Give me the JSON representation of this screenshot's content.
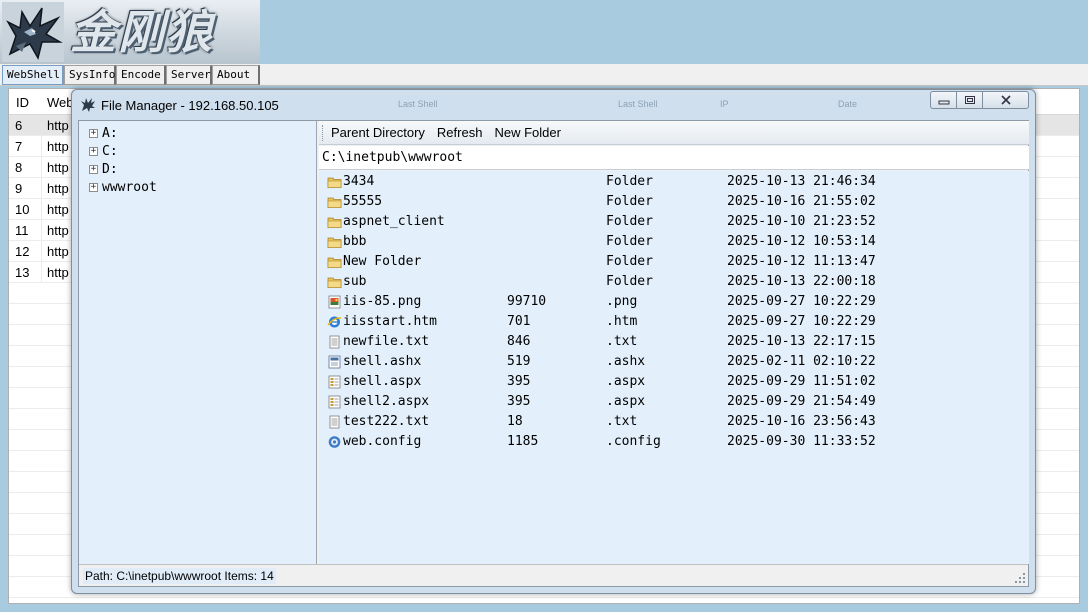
{
  "app": {
    "logo_text": "金刚狼"
  },
  "tabs": [
    {
      "label": "WebShell",
      "active": true
    },
    {
      "label": "SysInfo",
      "active": false
    },
    {
      "label": "Encode",
      "active": false
    },
    {
      "label": "Server",
      "active": false
    },
    {
      "label": "About",
      "active": false
    }
  ],
  "main_grid": {
    "headers": [
      "ID",
      "Web"
    ],
    "rows": [
      {
        "id": "6",
        "url": "http",
        "selected": true
      },
      {
        "id": "7",
        "url": "http",
        "selected": false
      },
      {
        "id": "8",
        "url": "http",
        "selected": false
      },
      {
        "id": "9",
        "url": "http",
        "selected": false
      },
      {
        "id": "10",
        "url": "http",
        "selected": false
      },
      {
        "id": "11",
        "url": "http",
        "selected": false
      },
      {
        "id": "12",
        "url": "http",
        "selected": false
      },
      {
        "id": "13",
        "url": "http",
        "selected": false
      }
    ]
  },
  "file_manager": {
    "title": "File Manager - 192.168.50.105",
    "ghost_headers": [
      "Last Shell",
      "Last Shell",
      "IP",
      "Date"
    ],
    "tree": [
      {
        "label": "A:"
      },
      {
        "label": "C:"
      },
      {
        "label": "D:"
      },
      {
        "label": "wwwroot"
      }
    ],
    "toolbar": {
      "parent_dir": "Parent Directory",
      "refresh": "Refresh",
      "new_folder": "New Folder"
    },
    "current_path": "C:\\inetpub\\wwwroot",
    "files": [
      {
        "name": "3434",
        "size": "",
        "type": "Folder",
        "date": "2025-10-13 21:46:34",
        "icon": "folder-icon"
      },
      {
        "name": "55555",
        "size": "",
        "type": "Folder",
        "date": "2025-10-16 21:55:02",
        "icon": "folder-icon"
      },
      {
        "name": "aspnet_client",
        "size": "",
        "type": "Folder",
        "date": "2025-10-10 21:23:52",
        "icon": "folder-icon"
      },
      {
        "name": "bbb",
        "size": "",
        "type": "Folder",
        "date": "2025-10-12 10:53:14",
        "icon": "folder-icon"
      },
      {
        "name": "New Folder",
        "size": "",
        "type": "Folder",
        "date": "2025-10-12 11:13:47",
        "icon": "folder-icon"
      },
      {
        "name": "sub",
        "size": "",
        "type": "Folder",
        "date": "2025-10-13 22:00:18",
        "icon": "folder-icon"
      },
      {
        "name": "iis-85.png",
        "size": "99710",
        "type": ".png",
        "date": "2025-09-27 10:22:29",
        "icon": "image-file-icon"
      },
      {
        "name": "iisstart.htm",
        "size": "701",
        "type": ".htm",
        "date": "2025-09-27 10:22:29",
        "icon": "ie-file-icon"
      },
      {
        "name": "newfile.txt",
        "size": "846",
        "type": ".txt",
        "date": "2025-10-13 22:17:15",
        "icon": "text-file-icon"
      },
      {
        "name": "shell.ashx",
        "size": "519",
        "type": ".ashx",
        "date": "2025-02-11 02:10:22",
        "icon": "handler-file-icon"
      },
      {
        "name": "shell.aspx",
        "size": "395",
        "type": ".aspx",
        "date": "2025-09-29 11:51:02",
        "icon": "aspx-file-icon"
      },
      {
        "name": "shell2.aspx",
        "size": "395",
        "type": ".aspx",
        "date": "2025-09-29 21:54:49",
        "icon": "aspx-file-icon"
      },
      {
        "name": "test222.txt",
        "size": "18",
        "type": ".txt",
        "date": "2025-10-16 23:56:43",
        "icon": "text-file-icon"
      },
      {
        "name": "web.config",
        "size": "1185",
        "type": ".config",
        "date": "2025-09-30 11:33:52",
        "icon": "config-file-icon"
      }
    ],
    "status": "Path: C:\\inetpub\\wwwroot  Items: 14"
  },
  "colors": {
    "background": "#a9cbe0",
    "list_background": "#e3f0fb",
    "folder": "#e8c25a"
  }
}
